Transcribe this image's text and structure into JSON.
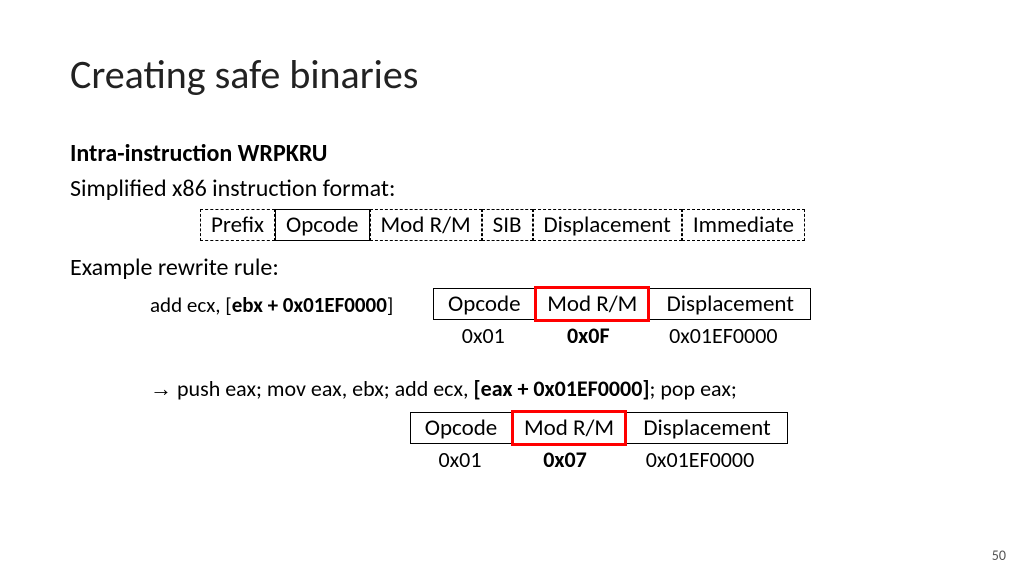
{
  "title": "Creating safe binaries",
  "subtitle": "Intra-instruction WRPKRU",
  "format_intro": "Simplified x86 instruction format:",
  "format_cells": {
    "prefix": "Prefix",
    "opcode": "Opcode",
    "modrm": "Mod R/M",
    "sib": "SIB",
    "disp": "Displacement",
    "imm": "Immediate"
  },
  "example_intro": "Example rewrite rule:",
  "instr1": {
    "pre": "add ecx, [",
    "bold": "ebx + 0x01EF0000",
    "post": "]"
  },
  "table_hdr": {
    "opcode": "Opcode",
    "modrm": "Mod R/M",
    "disp": "Displacement"
  },
  "table1_vals": {
    "opcode": "0x01",
    "modrm": "0x0F",
    "disp": "0x01EF0000"
  },
  "rewrite": {
    "arrow": "→",
    "pre": " push eax; mov eax, ebx; add ecx, ",
    "bold": "[eax + 0x01EF0000]",
    "post": "; pop eax;"
  },
  "table2_vals": {
    "opcode": "0x01",
    "modrm": "0x07",
    "disp": "0x01EF0000"
  },
  "page_number": "50"
}
